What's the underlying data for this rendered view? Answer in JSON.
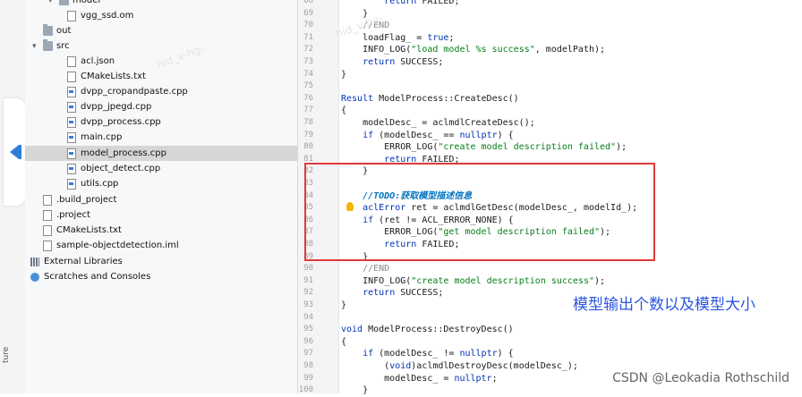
{
  "project_tree": [
    {
      "label": "model",
      "icon": "folder-icon",
      "name": "tree-folder-model"
    },
    {
      "label": "vgg_ssd.om",
      "icon": "file-icon",
      "name": "tree-file-vgg_ssd"
    },
    {
      "label": "out",
      "icon": "folder-icon",
      "name": "tree-folder-out"
    },
    {
      "label": "src",
      "icon": "folder-icon",
      "name": "tree-folder-src"
    },
    {
      "label": "acl.json",
      "icon": "file-icon",
      "name": "tree-file-acl-json"
    },
    {
      "label": "CMakeLists.txt",
      "icon": "file-icon",
      "name": "tree-file-cmakelists-src"
    },
    {
      "label": "dvpp_cropandpaste.cpp",
      "icon": "cpp-file-icon",
      "name": "tree-file-dvpp-cropandpaste"
    },
    {
      "label": "dvpp_jpegd.cpp",
      "icon": "cpp-file-icon",
      "name": "tree-file-dvpp-jpegd"
    },
    {
      "label": "dvpp_process.cpp",
      "icon": "cpp-file-icon",
      "name": "tree-file-dvpp-process"
    },
    {
      "label": "main.cpp",
      "icon": "cpp-file-icon",
      "name": "tree-file-main"
    },
    {
      "label": "model_process.cpp",
      "icon": "cpp-file-icon",
      "name": "tree-file-model-process"
    },
    {
      "label": "object_detect.cpp",
      "icon": "cpp-file-icon",
      "name": "tree-file-object-detect"
    },
    {
      "label": "utils.cpp",
      "icon": "cpp-file-icon",
      "name": "tree-file-utils"
    },
    {
      "label": ".build_project",
      "icon": "file-icon",
      "name": "tree-file-build-project"
    },
    {
      "label": ".project",
      "icon": "file-icon",
      "name": "tree-file-project"
    },
    {
      "label": "CMakeLists.txt",
      "icon": "file-icon",
      "name": "tree-file-cmakelists-root"
    },
    {
      "label": "sample-objectdetection.iml",
      "icon": "file-icon",
      "name": "tree-file-iml"
    },
    {
      "label": "External Libraries",
      "icon": "library-icon",
      "name": "tree-external-libraries"
    },
    {
      "label": "Scratches and Consoles",
      "icon": "scratch-icon",
      "name": "tree-scratches"
    }
  ],
  "selected_file": "model_process.cpp",
  "side_tab_label": "ture",
  "code_lines": [
    {
      "n": "68",
      "text": "        return FAILED;"
    },
    {
      "n": "69",
      "text": "    }"
    },
    {
      "n": "70",
      "text": "    //END"
    },
    {
      "n": "71",
      "text": "    loadFlag_ = true;"
    },
    {
      "n": "72",
      "text": "    INFO_LOG(\"load model %s success\", modelPath);"
    },
    {
      "n": "73",
      "text": "    return SUCCESS;"
    },
    {
      "n": "74",
      "text": "}"
    },
    {
      "n": "75",
      "text": ""
    },
    {
      "n": "76",
      "text": "Result ModelProcess::CreateDesc()"
    },
    {
      "n": "77",
      "text": "{"
    },
    {
      "n": "78",
      "text": "    modelDesc_ = aclmdlCreateDesc();"
    },
    {
      "n": "79",
      "text": "    if (modelDesc_ == nullptr) {"
    },
    {
      "n": "80",
      "text": "        ERROR_LOG(\"create model description failed\");"
    },
    {
      "n": "81",
      "text": "        return FAILED;"
    },
    {
      "n": "82",
      "text": "    }"
    },
    {
      "n": "83",
      "text": ""
    },
    {
      "n": "84",
      "text": "    //TODO:获取模型描述信息"
    },
    {
      "n": "85",
      "text": "    aclError ret = aclmdlGetDesc(modelDesc_, modelId_);"
    },
    {
      "n": "86",
      "text": "    if (ret != ACL_ERROR_NONE) {"
    },
    {
      "n": "87",
      "text": "        ERROR_LOG(\"get model description failed\");"
    },
    {
      "n": "88",
      "text": "        return FAILED;"
    },
    {
      "n": "89",
      "text": "    }"
    },
    {
      "n": "90",
      "text": "    //END"
    },
    {
      "n": "91",
      "text": "    INFO_LOG(\"create model description success\");"
    },
    {
      "n": "92",
      "text": "    return SUCCESS;"
    },
    {
      "n": "93",
      "text": "}"
    },
    {
      "n": "94",
      "text": ""
    },
    {
      "n": "95",
      "text": "void ModelProcess::DestroyDesc()"
    },
    {
      "n": "96",
      "text": "{"
    },
    {
      "n": "97",
      "text": "    if (modelDesc_ != nullptr) {"
    },
    {
      "n": "98",
      "text": "        (void)aclmdlDestroyDesc(modelDesc_);"
    },
    {
      "n": "99",
      "text": "        modelDesc_ = nullptr;"
    },
    {
      "n": "100",
      "text": "    }"
    }
  ],
  "annotation": "模型输出个数以及模型大小",
  "watermark": "CSDN @Leokadia Rothschild",
  "ghost_watermarks": [
    "hid_v-hg-",
    "hid_v-hg-"
  ],
  "colors": {
    "annotation": "#2b54e2",
    "highlight_box": "#e03a3a",
    "accent": "#2f7fd8"
  }
}
